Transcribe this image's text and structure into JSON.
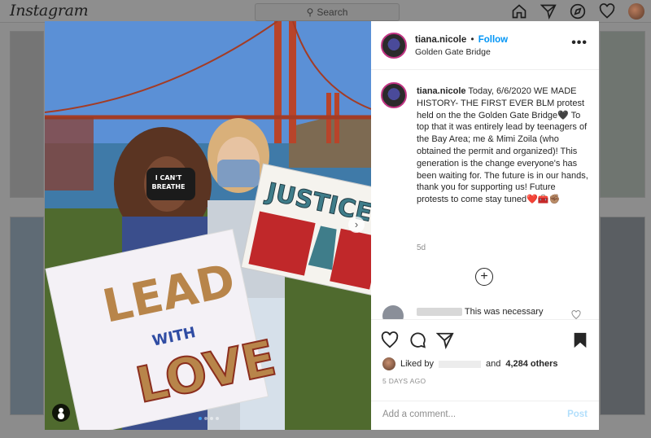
{
  "app": {
    "logo_text": "Instagram"
  },
  "nav": {
    "search_placeholder": "Search"
  },
  "post": {
    "username": "tiana.nicole",
    "separator": "•",
    "follow_label": "Follow",
    "location": "Golden Gate Bridge",
    "more_label": "•••",
    "caption": "Today, 6/6/2020 WE MADE HISTORY- THE FIRST EVER BLM protest held on the the Golden Gate Bridge🖤 To top that it was entirely lead by teenagers of the Bay Area; me & Mimi Zoila (who obtained the permit and organized)! This generation is the change everyone's has been waiting for. The future is in our hands, thank you for supporting us! Future protests to come stay tuned❤️🧰✊🏽",
    "caption_time": "5d",
    "load_more": "+",
    "comment_text": "This was necessary",
    "likes_prefix": "Liked by",
    "likes_suffix": "and",
    "likes_count": "4,284 others",
    "date": "5 DAYS AGO",
    "comment_placeholder": "Add a comment...",
    "post_button": "Post"
  },
  "photo": {
    "sign_left_line1": "LEAD",
    "sign_left_line2": "WITH",
    "sign_left_line3": "LOVE",
    "sign_right": "JUSTICE",
    "mask_text_line1": "I CAN'T",
    "mask_text_line2": "BREATHE",
    "carousel_count": 4,
    "carousel_active": 1
  },
  "colors": {
    "accent": "#0095f6",
    "story_ring": "#c13584",
    "overlay_bg": "#8c8c8c"
  }
}
